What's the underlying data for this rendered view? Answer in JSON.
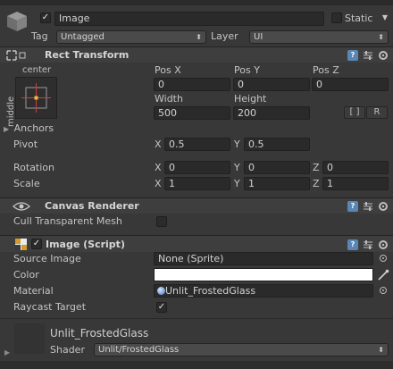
{
  "header": {
    "active": true,
    "name": "Image",
    "static_label": "Static",
    "tag_label": "Tag",
    "tag_value": "Untagged",
    "layer_label": "Layer",
    "layer_value": "UI"
  },
  "rect_transform": {
    "title": "Rect Transform",
    "anchor_top": "center",
    "anchor_side": "middle",
    "col_headers": [
      "Pos X",
      "Pos Y",
      "Pos Z"
    ],
    "pos_x": "0",
    "pos_y": "0",
    "pos_z": "0",
    "width_label": "Width",
    "height_label": "Height",
    "width": "500",
    "height": "200",
    "blueprint_btn": "[ ]",
    "raw_btn": "R",
    "anchors_label": "Anchors",
    "pivot_label": "Pivot",
    "pivot_x": "0.5",
    "pivot_y": "0.5",
    "rotation_label": "Rotation",
    "rot_x": "0",
    "rot_y": "0",
    "rot_z": "0",
    "scale_label": "Scale",
    "scale_x": "1",
    "scale_y": "1",
    "scale_z": "1",
    "axis_x": "X",
    "axis_y": "Y",
    "axis_z": "Z"
  },
  "canvas_renderer": {
    "title": "Canvas Renderer",
    "cull_label": "Cull Transparent Mesh",
    "cull_checked": false
  },
  "image_script": {
    "title": "Image (Script)",
    "enabled": true,
    "source_image_label": "Source Image",
    "source_image_value": "None (Sprite)",
    "color_label": "Color",
    "color_value": "#ffffff",
    "material_label": "Material",
    "material_value": "Unlit_FrostedGlass",
    "raycast_label": "Raycast Target",
    "raycast_checked": true
  },
  "material_preview": {
    "name": "Unlit_FrostedGlass",
    "shader_label": "Shader",
    "shader_value": "Unlit/FrostedGlass"
  },
  "colors": {
    "panel": "#383838",
    "header": "#3e3e3e",
    "field": "#2a2a2a",
    "help": "#5a86b5",
    "anchor_red": "#d23c3c",
    "anchor_yellow": "#e0c040"
  }
}
